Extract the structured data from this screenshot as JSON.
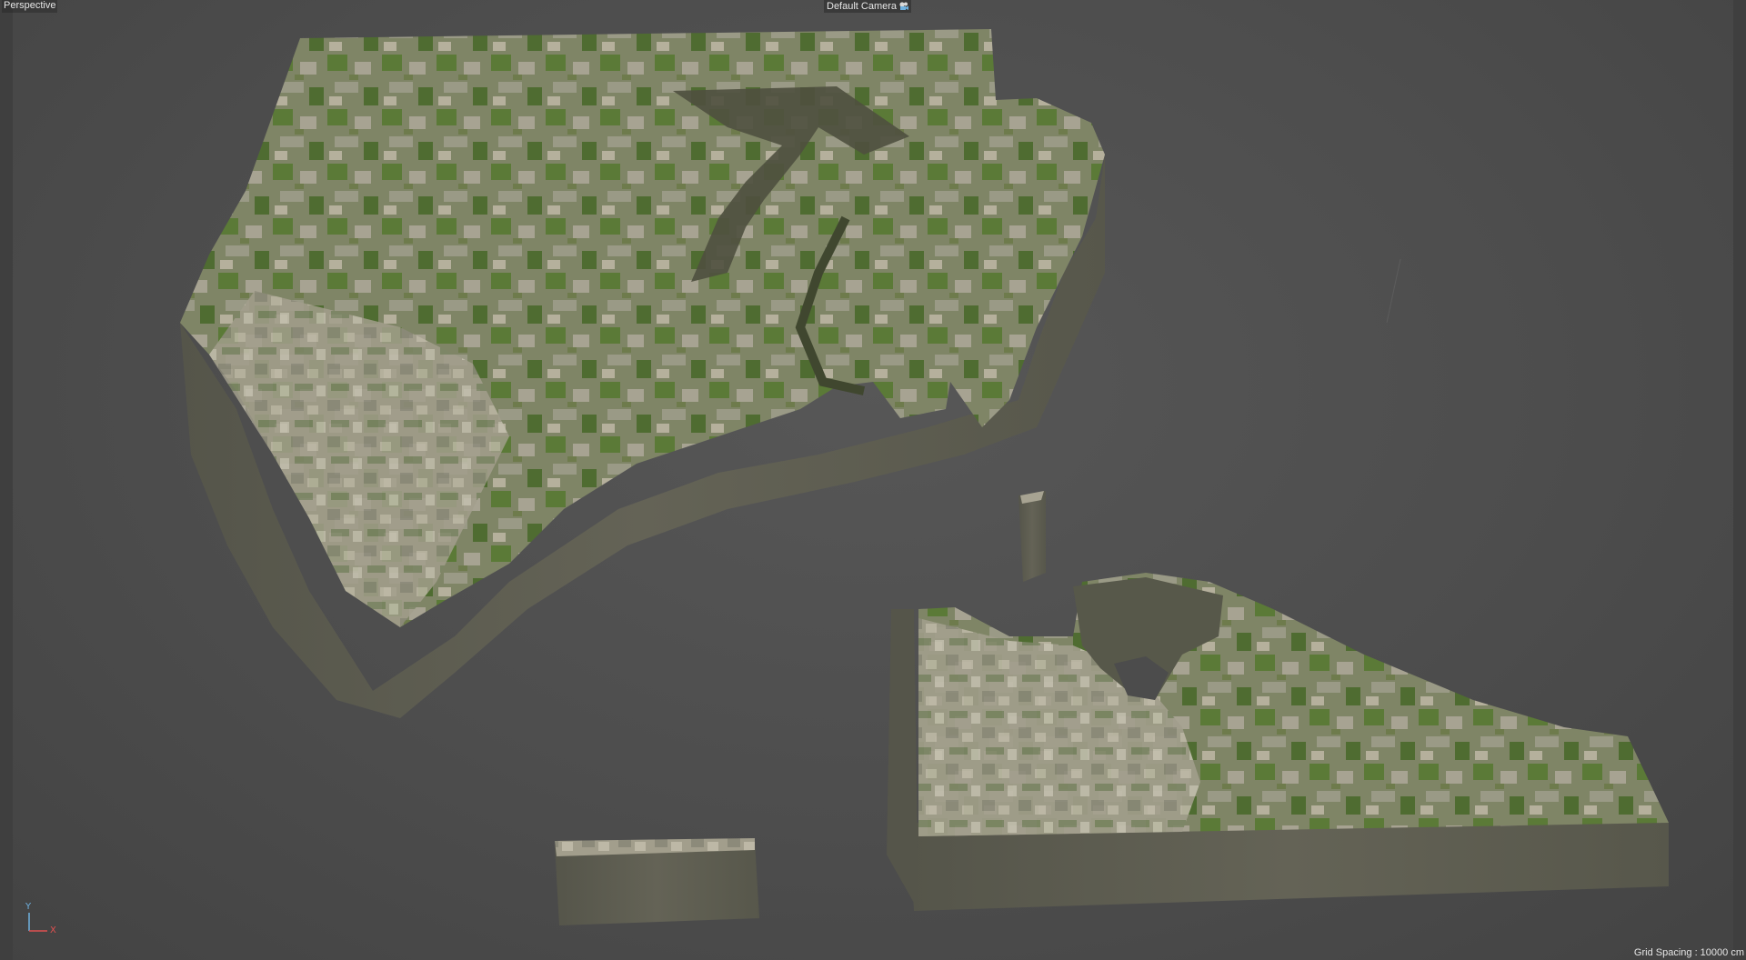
{
  "viewport": {
    "view_label": "Perspective",
    "camera_label": "Default Camera",
    "camera_icon": "camera-icon",
    "grid_spacing": "Grid Spacing : 10000 cm",
    "axis": {
      "y_label": "Y",
      "x_label": "X"
    }
  },
  "colors": {
    "background": "#4a4a4a",
    "terrain_side": "#5f5e52",
    "terrain_top_green": "#5e7a3c",
    "terrain_top_urban": "#9c9886",
    "axis_x": "#e05050",
    "axis_y": "#6fb1e0"
  }
}
